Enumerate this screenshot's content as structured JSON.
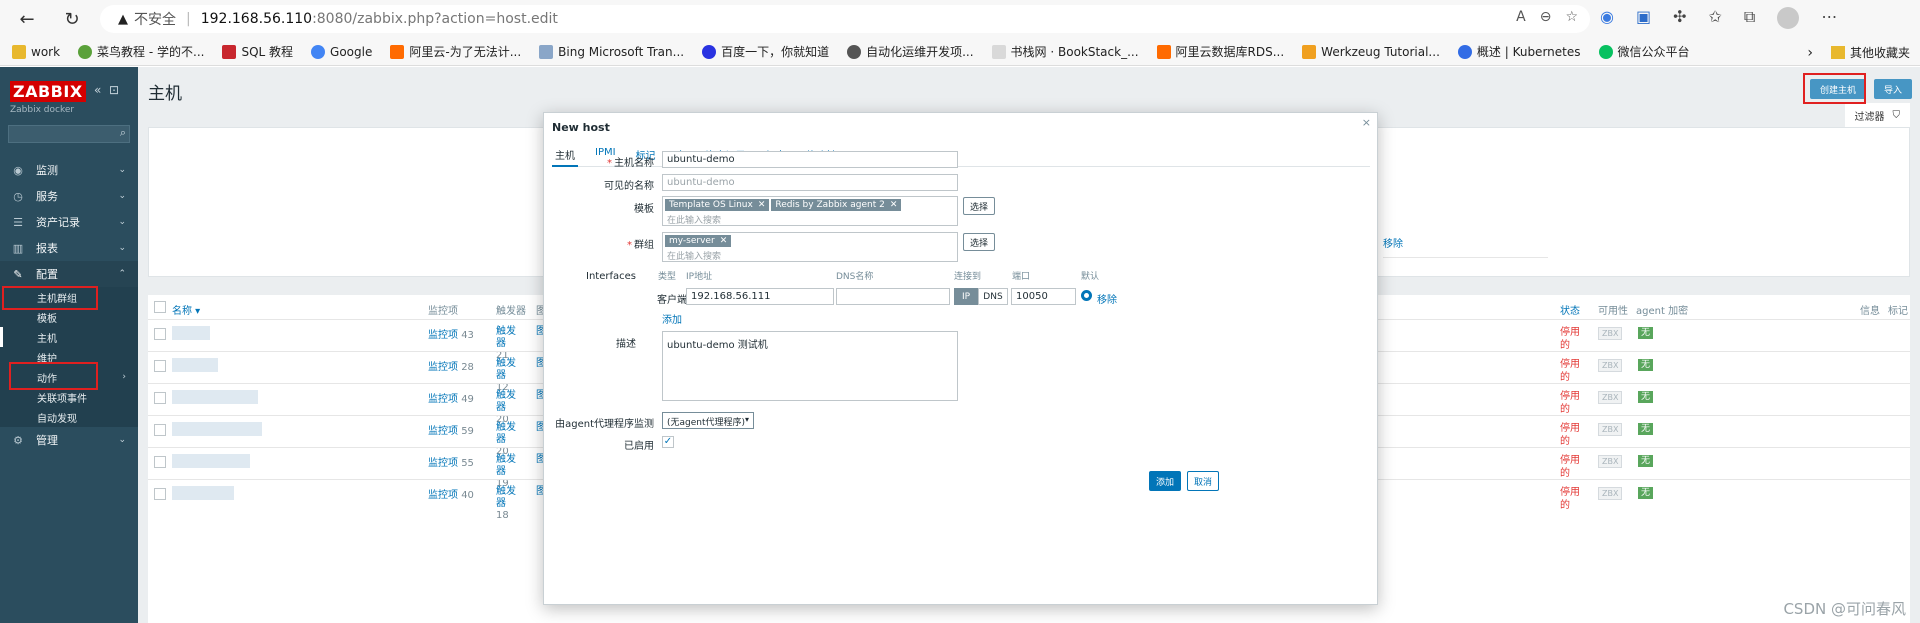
{
  "browser": {
    "insecure_label": "不安全",
    "url_host": "192.168.56.110",
    "url_path": ":8080/zabbix.php?action=host.edit",
    "bookmarks": [
      "work",
      "菜鸟教程 - 学的不...",
      "SQL 教程",
      "Google",
      "阿里云-为了无法计...",
      "Bing Microsoft Tran...",
      "百度一下，你就知道",
      "自动化运维开发项...",
      "书栈网 · BookStack_...",
      "阿里云数据库RDS...",
      "Werkzeug Tutorial...",
      "概述 | Kubernetes",
      "微信公众平台"
    ],
    "other_bookmarks": "其他收藏夹"
  },
  "sidebar": {
    "logo": "ZABBIX",
    "subtitle": "Zabbix docker",
    "menu": [
      "监测",
      "服务",
      "资产记录",
      "报表",
      "配置",
      "管理"
    ],
    "config_items": [
      "主机群组",
      "模板",
      "主机",
      "维护",
      "动作",
      "关联项事件",
      "自动发现"
    ]
  },
  "page": {
    "title": "主机",
    "create_host": "创建主机",
    "import": "导入",
    "filter": "过滤器",
    "remove": "移除"
  },
  "table": {
    "headers": {
      "name": "名称 ▾",
      "items": "监控项",
      "triggers": "触发器",
      "graphs": "图",
      "status": "状态",
      "availability": "可用性",
      "agent_enc": "agent 加密",
      "info": "信息",
      "tags": "标记"
    },
    "rows": [
      {
        "items_label": "监控项",
        "items": "43",
        "triggers_label": "触发器",
        "triggers": "21",
        "status": "停用的",
        "zbx": "ZBX",
        "enc": "无"
      },
      {
        "items_label": "监控项",
        "items": "28",
        "triggers_label": "触发器",
        "triggers": "12",
        "status": "停用的",
        "zbx": "ZBX",
        "enc": "无"
      },
      {
        "items_label": "监控项",
        "items": "49",
        "triggers_label": "触发器",
        "triggers": "20",
        "status": "停用的",
        "zbx": "ZBX",
        "enc": "无"
      },
      {
        "items_label": "监控项",
        "items": "59",
        "triggers_label": "触发器",
        "triggers": "20",
        "status": "停用的",
        "zbx": "ZBX",
        "enc": "无"
      },
      {
        "items_label": "监控项",
        "items": "55",
        "triggers_label": "触发器",
        "triggers": "19",
        "status": "停用的",
        "zbx": "ZBX",
        "enc": "无"
      },
      {
        "items_label": "监控项",
        "items": "40",
        "triggers_label": "触发器",
        "triggers": "18",
        "status": "停用的",
        "zbx": "ZBX",
        "enc": "无"
      }
    ]
  },
  "modal": {
    "title": "New host",
    "tabs": [
      "主机",
      "IPMI",
      "标记",
      "宏",
      "资产记录",
      "加密",
      "值映射"
    ],
    "host_name_label": "主机名称",
    "host_name": "ubuntu-demo",
    "visible_name_label": "可见的名称",
    "visible_name_placeholder": "ubuntu-demo",
    "templates_label": "模板",
    "templates": [
      "Template OS Linux",
      "Redis by Zabbix agent 2"
    ],
    "search_placeholder": "在此输入搜索",
    "select_btn": "选择",
    "groups_label": "群组",
    "groups": [
      "my-server"
    ],
    "interfaces_label": "Interfaces",
    "if_headers": {
      "type": "类型",
      "ip": "IP地址",
      "dns": "DNS名称",
      "connect": "连接到",
      "port": "端口",
      "default": "默认"
    },
    "if_type": "客户端",
    "ip": "192.168.56.111",
    "dns": "",
    "connect_ip": "IP",
    "connect_dns": "DNS",
    "port": "10050",
    "if_remove": "移除",
    "add_link": "添加",
    "description_label": "描述",
    "description": "ubuntu-demo 测试机",
    "proxy_label": "由agent代理程序监测",
    "proxy_value": "(无agent代理程序)",
    "enabled_label": "已启用",
    "add_btn": "添加",
    "cancel_btn": "取消"
  },
  "watermark": "CSDN @可问春风"
}
